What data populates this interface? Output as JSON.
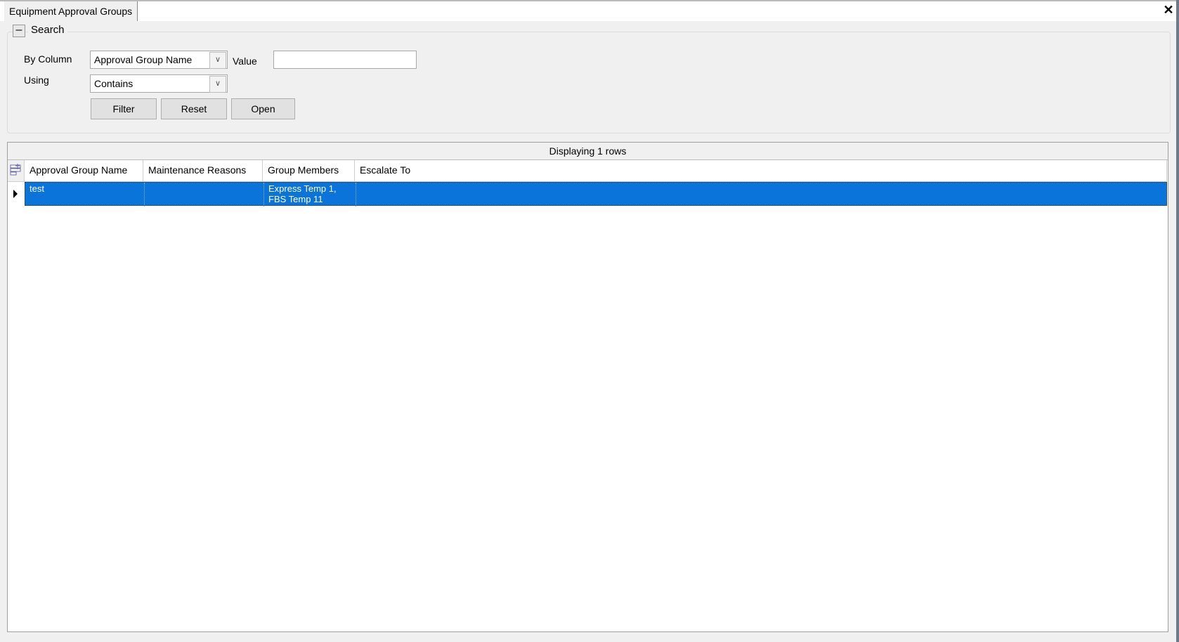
{
  "window": {
    "tab_title": "Equipment Approval Groups",
    "close_icon": "close-icon"
  },
  "search": {
    "group_title": "Search",
    "collapse_icon": "minus",
    "by_column_label": "By Column",
    "by_column_value": "Approval Group Name",
    "value_label": "Value",
    "value_input": "",
    "using_label": "Using",
    "using_value": "Contains",
    "buttons": {
      "filter": "Filter",
      "reset": "Reset",
      "open": "Open"
    }
  },
  "grid": {
    "caption": "Displaying 1 rows",
    "columns": [
      "Approval Group Name",
      "Maintenance Reasons",
      "Group Members",
      "Escalate To"
    ],
    "rows": [
      {
        "approval_group_name": "test",
        "maintenance_reasons": "",
        "group_members": "Express Temp 1, FBS Temp 11",
        "escalate_to": ""
      }
    ],
    "selection_color": "#0a74da"
  }
}
